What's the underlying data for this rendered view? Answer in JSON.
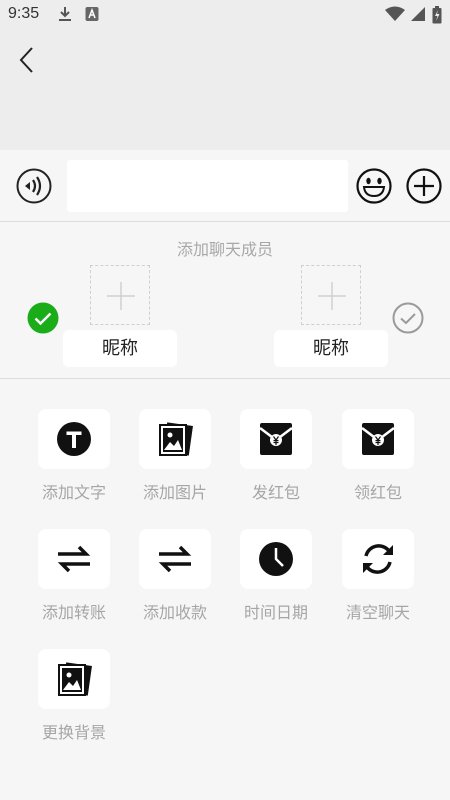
{
  "status_bar": {
    "time": "9:35",
    "icons": [
      "download-icon",
      "a-icon",
      "wifi-icon",
      "signal-icon",
      "battery-icon"
    ]
  },
  "header": {
    "back_icon": "chevron-left-icon"
  },
  "input_bar": {
    "voice_icon": "voice-icon",
    "text_value": "",
    "emoji_icon": "smiley-icon",
    "plus_icon": "plus-circle-icon"
  },
  "members": {
    "title": "添加聊天成员",
    "left": {
      "nickname": "昵称",
      "selected": true
    },
    "right": {
      "nickname": "昵称",
      "selected": false
    }
  },
  "tools": [
    {
      "label": "添加文字",
      "icon": "text-icon"
    },
    {
      "label": "添加图片",
      "icon": "image-icon"
    },
    {
      "label": "发红包",
      "icon": "red-envelope-icon"
    },
    {
      "label": "领红包",
      "icon": "red-envelope-icon"
    },
    {
      "label": "添加转账",
      "icon": "transfer-icon"
    },
    {
      "label": "添加收款",
      "icon": "transfer-icon"
    },
    {
      "label": "时间日期",
      "icon": "clock-icon"
    },
    {
      "label": "清空聊天",
      "icon": "refresh-icon"
    },
    {
      "label": "更换背景",
      "icon": "image-icon"
    }
  ],
  "colors": {
    "accent_green": "#1aad19",
    "background": "#f6f6f6",
    "header_bg": "#ededed"
  }
}
